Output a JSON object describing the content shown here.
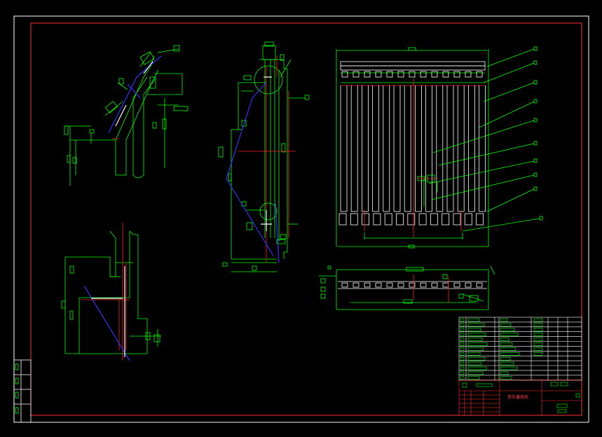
{
  "title_block": {
    "drawing_name": "音乐播放机"
  },
  "colors": {
    "background": "#000000",
    "frame": "#ffffff",
    "border": "#ff3030",
    "geometry": "#00ff00",
    "hidden_line": "#3333ff",
    "center_line": "#ff2020",
    "white_line": "#ffffff"
  }
}
